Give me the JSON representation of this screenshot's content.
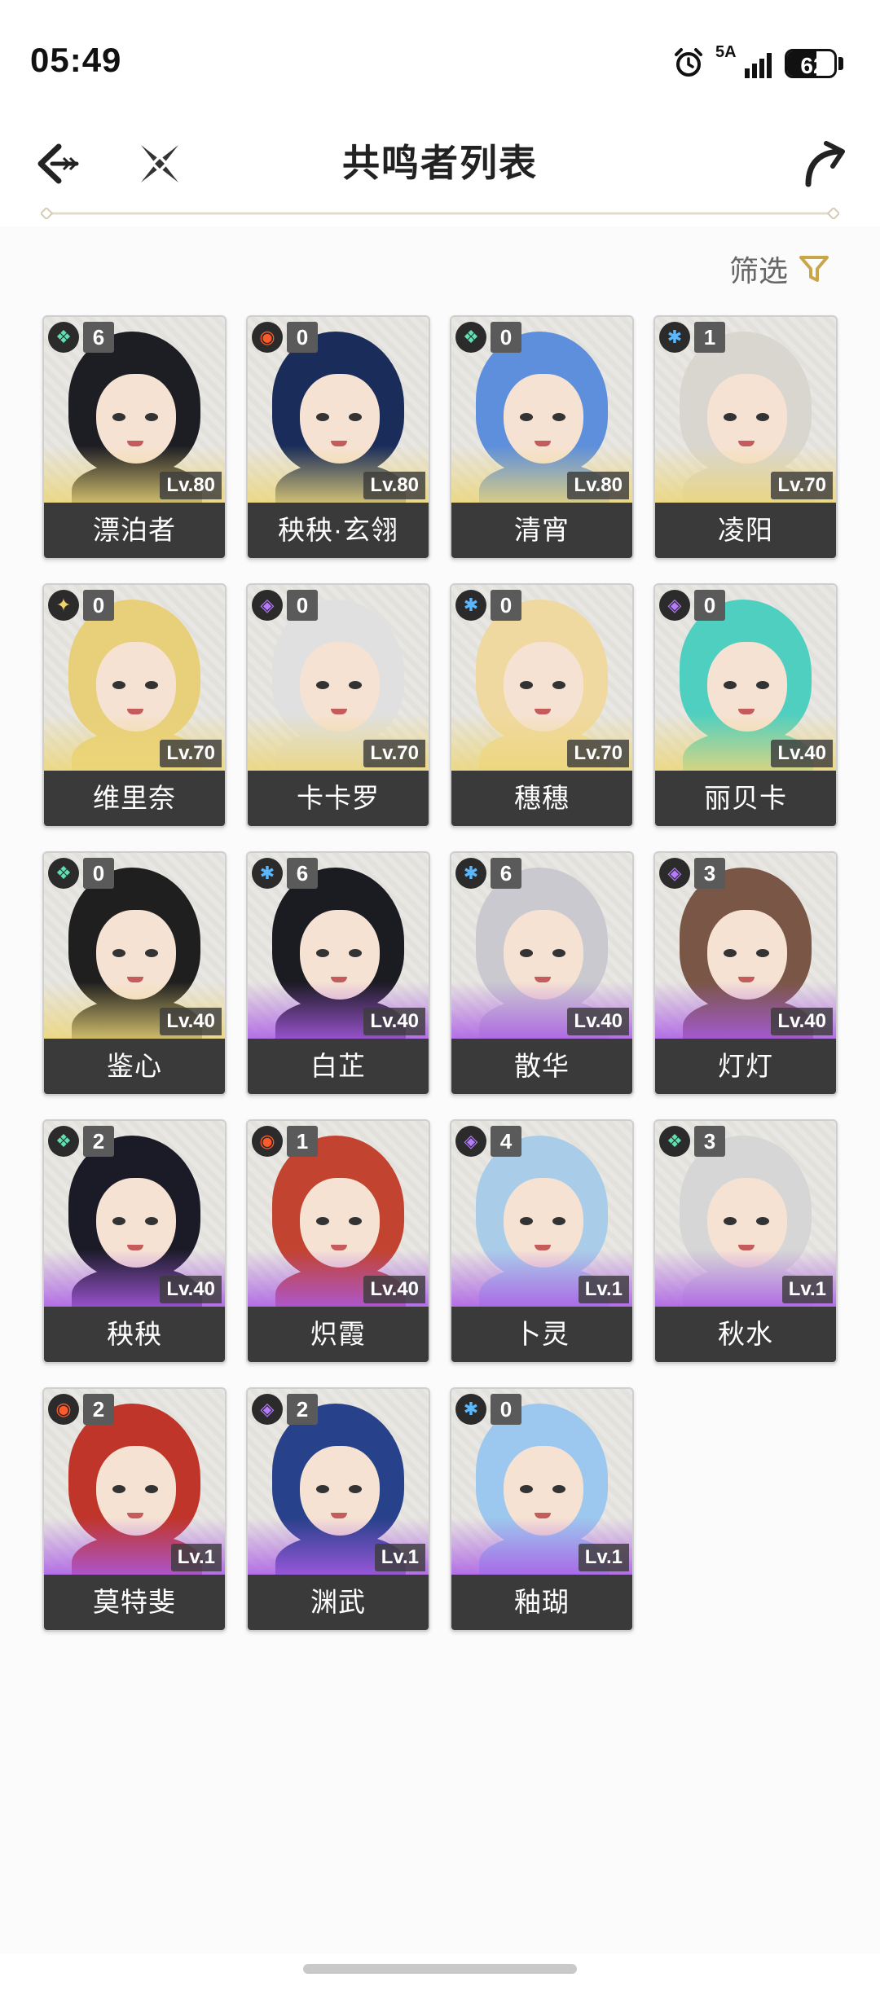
{
  "status_bar": {
    "time": "05:49",
    "network": "5A",
    "battery": "62",
    "battery_level": 0.62
  },
  "header": {
    "title": "共鸣者列表"
  },
  "filter": {
    "label": "筛选"
  },
  "characters": [
    {
      "name": "漂泊者",
      "rank": "6",
      "level": "Lv.80",
      "element": "aero",
      "hair": "#1d1d24",
      "frame": "gold"
    },
    {
      "name": "秧秧·玄翎",
      "rank": "0",
      "level": "Lv.80",
      "element": "fusion",
      "hair": "#1a2c5a",
      "frame": "gold"
    },
    {
      "name": "清宵",
      "rank": "0",
      "level": "Lv.80",
      "element": "aero",
      "hair": "#5d8fdc",
      "frame": "gold"
    },
    {
      "name": "凌阳",
      "rank": "1",
      "level": "Lv.70",
      "element": "glacio",
      "hair": "#d9d6cf",
      "frame": "gold"
    },
    {
      "name": "维里奈",
      "rank": "0",
      "level": "Lv.70",
      "element": "spectro",
      "hair": "#e8cf7a",
      "frame": "gold"
    },
    {
      "name": "卡卡罗",
      "rank": "0",
      "level": "Lv.70",
      "element": "electro",
      "hair": "#e0e0e0",
      "frame": "gold"
    },
    {
      "name": "穗穗",
      "rank": "0",
      "level": "Lv.70",
      "element": "glacio",
      "hair": "#f0d9a0",
      "frame": "gold"
    },
    {
      "name": "丽贝卡",
      "rank": "0",
      "level": "Lv.40",
      "element": "electro",
      "hair": "#4fcfc0",
      "frame": "gold"
    },
    {
      "name": "鉴心",
      "rank": "0",
      "level": "Lv.40",
      "element": "aero",
      "hair": "#1f1f1f",
      "frame": "gold"
    },
    {
      "name": "白芷",
      "rank": "6",
      "level": "Lv.40",
      "element": "glacio",
      "hair": "#1b1b22",
      "frame": "purple"
    },
    {
      "name": "散华",
      "rank": "6",
      "level": "Lv.40",
      "element": "glacio",
      "hair": "#c9c9cf",
      "frame": "purple"
    },
    {
      "name": "灯灯",
      "rank": "3",
      "level": "Lv.40",
      "element": "electro",
      "hair": "#7a5646",
      "frame": "purple"
    },
    {
      "name": "秧秧",
      "rank": "2",
      "level": "Lv.40",
      "element": "aero",
      "hair": "#1b1b28",
      "frame": "purple"
    },
    {
      "name": "炽霞",
      "rank": "1",
      "level": "Lv.40",
      "element": "fusion",
      "hair": "#c2432f",
      "frame": "purple"
    },
    {
      "name": "卜灵",
      "rank": "4",
      "level": "Lv.1",
      "element": "electro",
      "hair": "#a9cde8",
      "frame": "purple"
    },
    {
      "name": "秋水",
      "rank": "3",
      "level": "Lv.1",
      "element": "aero",
      "hair": "#d6d6d6",
      "frame": "purple"
    },
    {
      "name": "莫特斐",
      "rank": "2",
      "level": "Lv.1",
      "element": "fusion",
      "hair": "#c0352a",
      "frame": "purple"
    },
    {
      "name": "渊武",
      "rank": "2",
      "level": "Lv.1",
      "element": "electro",
      "hair": "#27418a",
      "frame": "purple"
    },
    {
      "name": "釉瑚",
      "rank": "0",
      "level": "Lv.1",
      "element": "glacio",
      "hair": "#9cc7ee",
      "frame": "purple"
    }
  ],
  "element_icons": {
    "aero": {
      "glyph": "❖",
      "color": "#5fe0b0"
    },
    "fusion": {
      "glyph": "◉",
      "color": "#ff5a2a"
    },
    "glacio": {
      "glyph": "✱",
      "color": "#5ab8ff"
    },
    "spectro": {
      "glyph": "✦",
      "color": "#f2d36a"
    },
    "electro": {
      "glyph": "◈",
      "color": "#b77bff"
    }
  },
  "colors": {
    "accent": "#c9a64a",
    "card_name_bg": "#3a3a3a"
  }
}
